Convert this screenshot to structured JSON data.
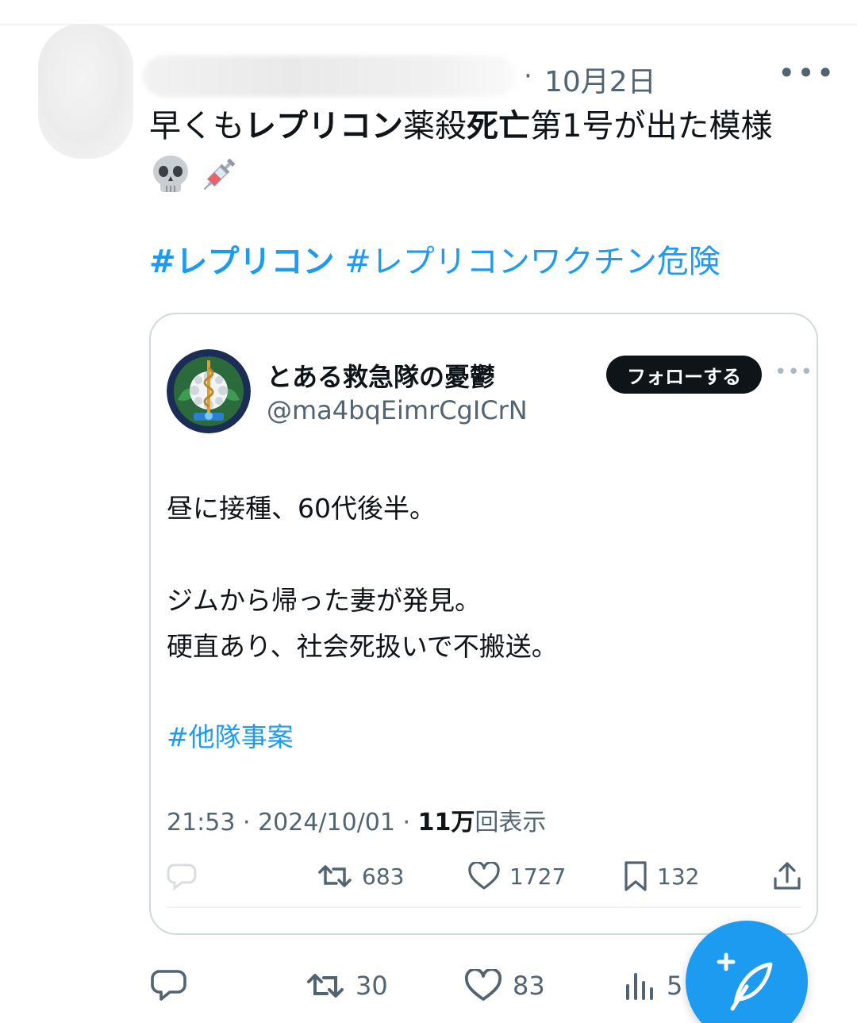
{
  "post": {
    "date": "10月2日",
    "date_sep": "·",
    "more": "•••",
    "text": {
      "p1": "早くも",
      "b1": "レプリコン",
      "p2": "薬殺",
      "b2": "死亡",
      "p3": "第1号が出た模様"
    },
    "emojis": [
      "skull-emoji",
      "syringe-emoji"
    ],
    "hashtags": [
      "#レプリコン",
      "#レプリコンワクチン危険"
    ]
  },
  "embedded": {
    "name": "とある救急隊の憂鬱",
    "handle": "@ma4bqEimrCgICrN",
    "follow_label": "フォローする",
    "more": "•••",
    "lines": [
      "昼に接種、60代後半。",
      "ジムから帰った妻が発見。",
      "硬直あり、社会死扱いで不搬送。"
    ],
    "hashtag": "#他隊事案",
    "time": "21:53 · 2024/10/01 · ",
    "views_count": "11万",
    "views_label": "回表示",
    "actions": {
      "retweets": "683",
      "likes": "1727",
      "bookmarks": "132"
    }
  },
  "actions": {
    "retweets": "30",
    "likes": "83",
    "views": "5"
  },
  "colors": {
    "accent": "#1d9bf0",
    "text": "#0f1419",
    "muted": "#536471",
    "border": "#cfd9de"
  }
}
